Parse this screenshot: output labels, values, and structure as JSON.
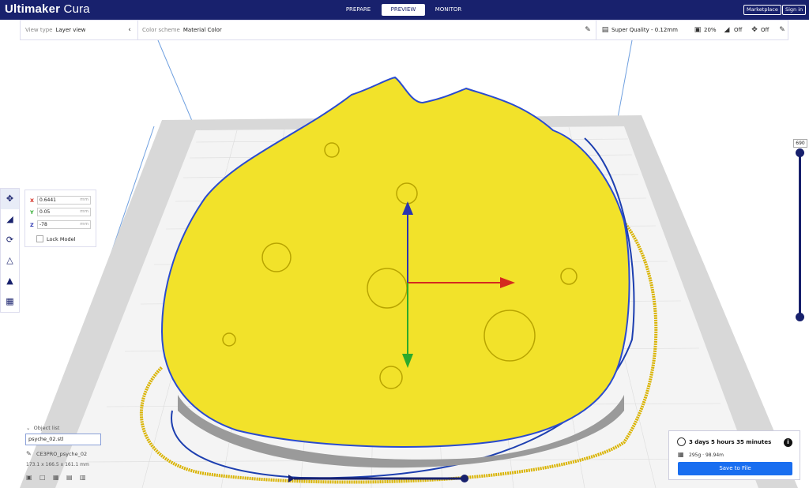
{
  "header": {
    "brand_bold": "Ultimaker",
    "brand_light": " Cura",
    "stages": [
      {
        "label": "PREPARE"
      },
      {
        "label": "PREVIEW"
      },
      {
        "label": "MONITOR"
      }
    ],
    "marketplace_label": "Marketplace",
    "signin_label": "Sign in"
  },
  "toolbar": {
    "view_type_label": "View type",
    "view_type_value": "Layer view",
    "color_scheme_label": "Color scheme",
    "color_scheme_value": "Material Color",
    "quality": "Super Quality - 0.12mm",
    "infill": "20%",
    "support": "Off",
    "adhesion": "Off"
  },
  "move_panel": {
    "x_label": "X",
    "x_value": "0.6441",
    "y_label": "Y",
    "y_value": "0.05",
    "z_label": "Z",
    "z_value": "-78",
    "unit": "mm",
    "lock_label": "Lock Model"
  },
  "layer_slider": {
    "value": "690"
  },
  "object_list": {
    "header": "Object list",
    "input_value": "psyche_02.stl",
    "object_name": "CE3PRO_psyche_02",
    "dimensions": "173.1 x 166.5 x 161.1 mm"
  },
  "print_panel": {
    "time": "3 days 5 hours 35 minutes",
    "material": "295g · 98.94m",
    "save_label": "Save to File"
  },
  "colors": {
    "header_bg": "#18216d",
    "model_yellow": "#f2e22a",
    "save_button": "#196ef0"
  }
}
